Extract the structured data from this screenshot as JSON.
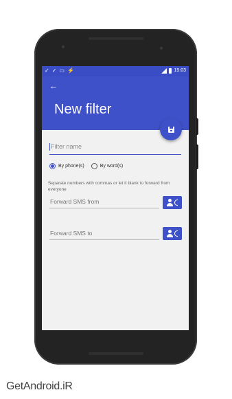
{
  "status_bar": {
    "time": "15:03",
    "left_icons": [
      "check-icon",
      "check-icon",
      "image-icon",
      "flash-icon"
    ]
  },
  "app_bar": {
    "back_icon": "arrow-left-icon",
    "title": "New filter",
    "fab_icon": "save-icon"
  },
  "form": {
    "filter_name_placeholder": "Filter name",
    "radio_options": [
      {
        "label": "By phone(s)",
        "selected": true
      },
      {
        "label": "By word(s)",
        "selected": false
      }
    ],
    "hint": "Separate numbers with commas or let it blank to forward from everyone",
    "forward_from_placeholder": "Forward SMS from",
    "forward_to_placeholder": "Forward SMS to",
    "contact_icon": "contact-phone-icon"
  },
  "watermark": "GetAndroid.iR",
  "colors": {
    "primary": "#3f51c8",
    "status_bar": "#3a4dc4",
    "screen_bg": "#f1f1f1",
    "phone_body": "#232323"
  }
}
